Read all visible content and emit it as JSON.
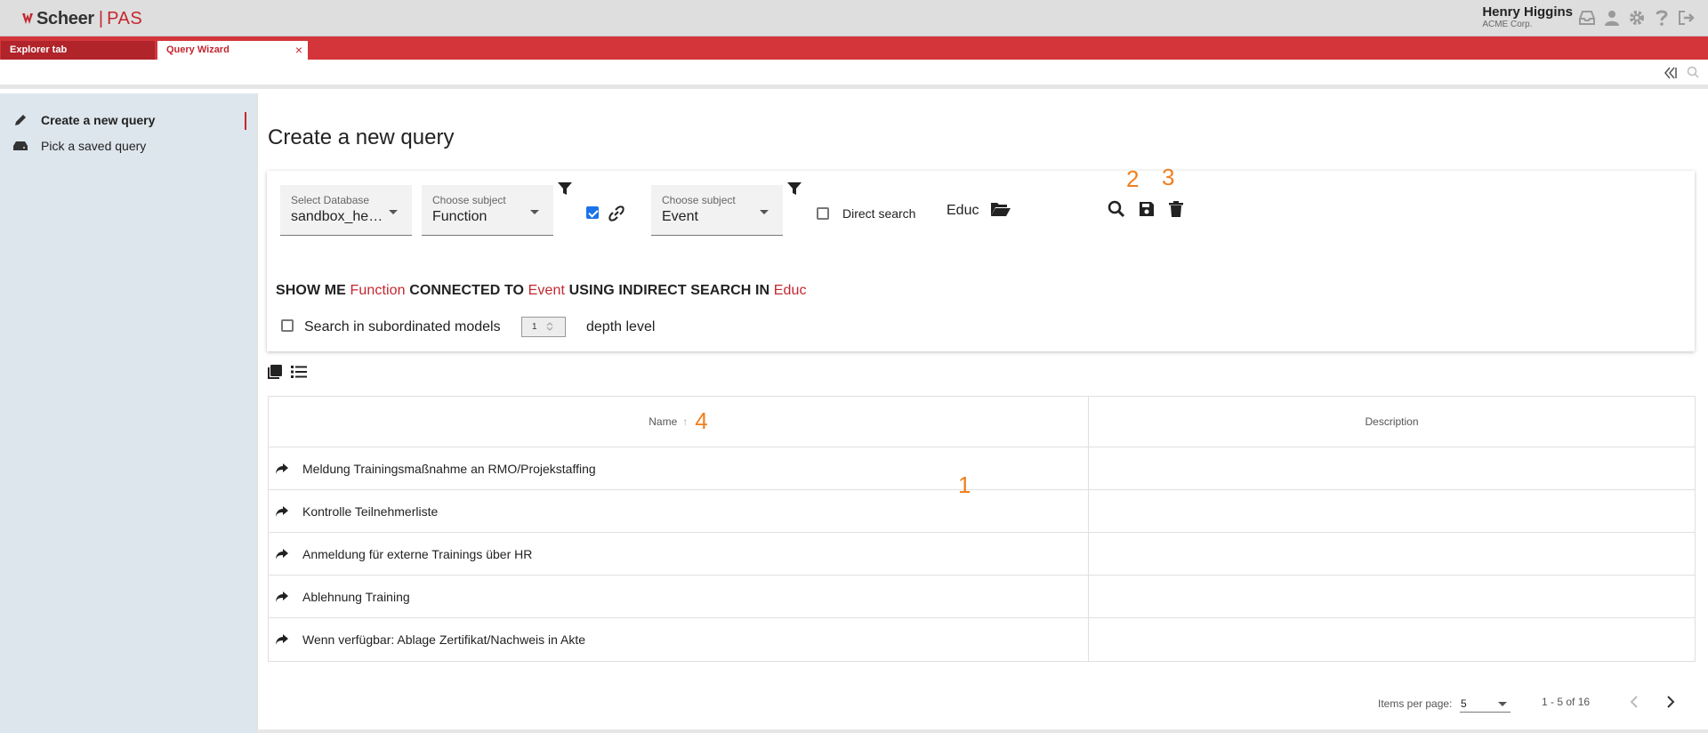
{
  "header": {
    "logo_main": "Scheer",
    "logo_sep": "|",
    "logo_product": "PAS",
    "user_name": "Henry Higgins",
    "user_company": "ACME Corp.",
    "icons": [
      "inbox-icon",
      "user-icon",
      "gear-icon",
      "help-icon",
      "logout-icon"
    ]
  },
  "tabs": [
    {
      "label": "Explorer tab"
    },
    {
      "label": "Query Wizard",
      "close": "×"
    }
  ],
  "sidebar": {
    "items": [
      {
        "label": "Create a new query",
        "icon": "pencil-icon",
        "active": true
      },
      {
        "label": "Pick a saved query",
        "icon": "drive-icon",
        "active": false
      }
    ]
  },
  "main": {
    "title": "Create a new query",
    "database_select": {
      "label": "Select Database",
      "value": "sandbox_hen…"
    },
    "subject1_select": {
      "label": "Choose subject",
      "value": "Function"
    },
    "subject2_select": {
      "label": "Choose subject",
      "value": "Event"
    },
    "link_checked": true,
    "direct_search": {
      "label": "Direct search",
      "checked": false
    },
    "folder_value": "Educ",
    "annotations": {
      "save": "2",
      "delete": "3",
      "sort": "4",
      "table": "1"
    },
    "sentence": {
      "p1": "SHOW ME",
      "v1": "Function",
      "p2": "CONNECTED TO",
      "v2": "Event",
      "p3": "USING INDIRECT SEARCH IN",
      "v3": "Educ"
    },
    "subordinated": {
      "label": "Search in subordinated models",
      "checked": false
    },
    "depth": {
      "value": "1",
      "label": "depth level"
    }
  },
  "table": {
    "columns": [
      "Name",
      "Description"
    ],
    "sort_indicator": "↑",
    "rows": [
      {
        "name": "Meldung Trainingsmaßnahme an RMO/Projekstaffing",
        "description": ""
      },
      {
        "name": "Kontrolle Teilnehmerliste",
        "description": ""
      },
      {
        "name": "Anmeldung für externe Trainings über HR",
        "description": ""
      },
      {
        "name": "Ablehnung Training",
        "description": ""
      },
      {
        "name": "Wenn verfügbar: Ablage Zertifikat/Nachweis in Akte",
        "description": ""
      }
    ]
  },
  "pager": {
    "items_label": "Items per page:",
    "items_value": "5",
    "range": "1 - 5 of 16"
  },
  "colors": {
    "brand_red": "#c4262e",
    "tabbar": "#d3353b",
    "sidebar_bg": "#dde6ec",
    "annotation_orange": "#f07f1f",
    "checkbox_blue": "#1a73e8"
  }
}
